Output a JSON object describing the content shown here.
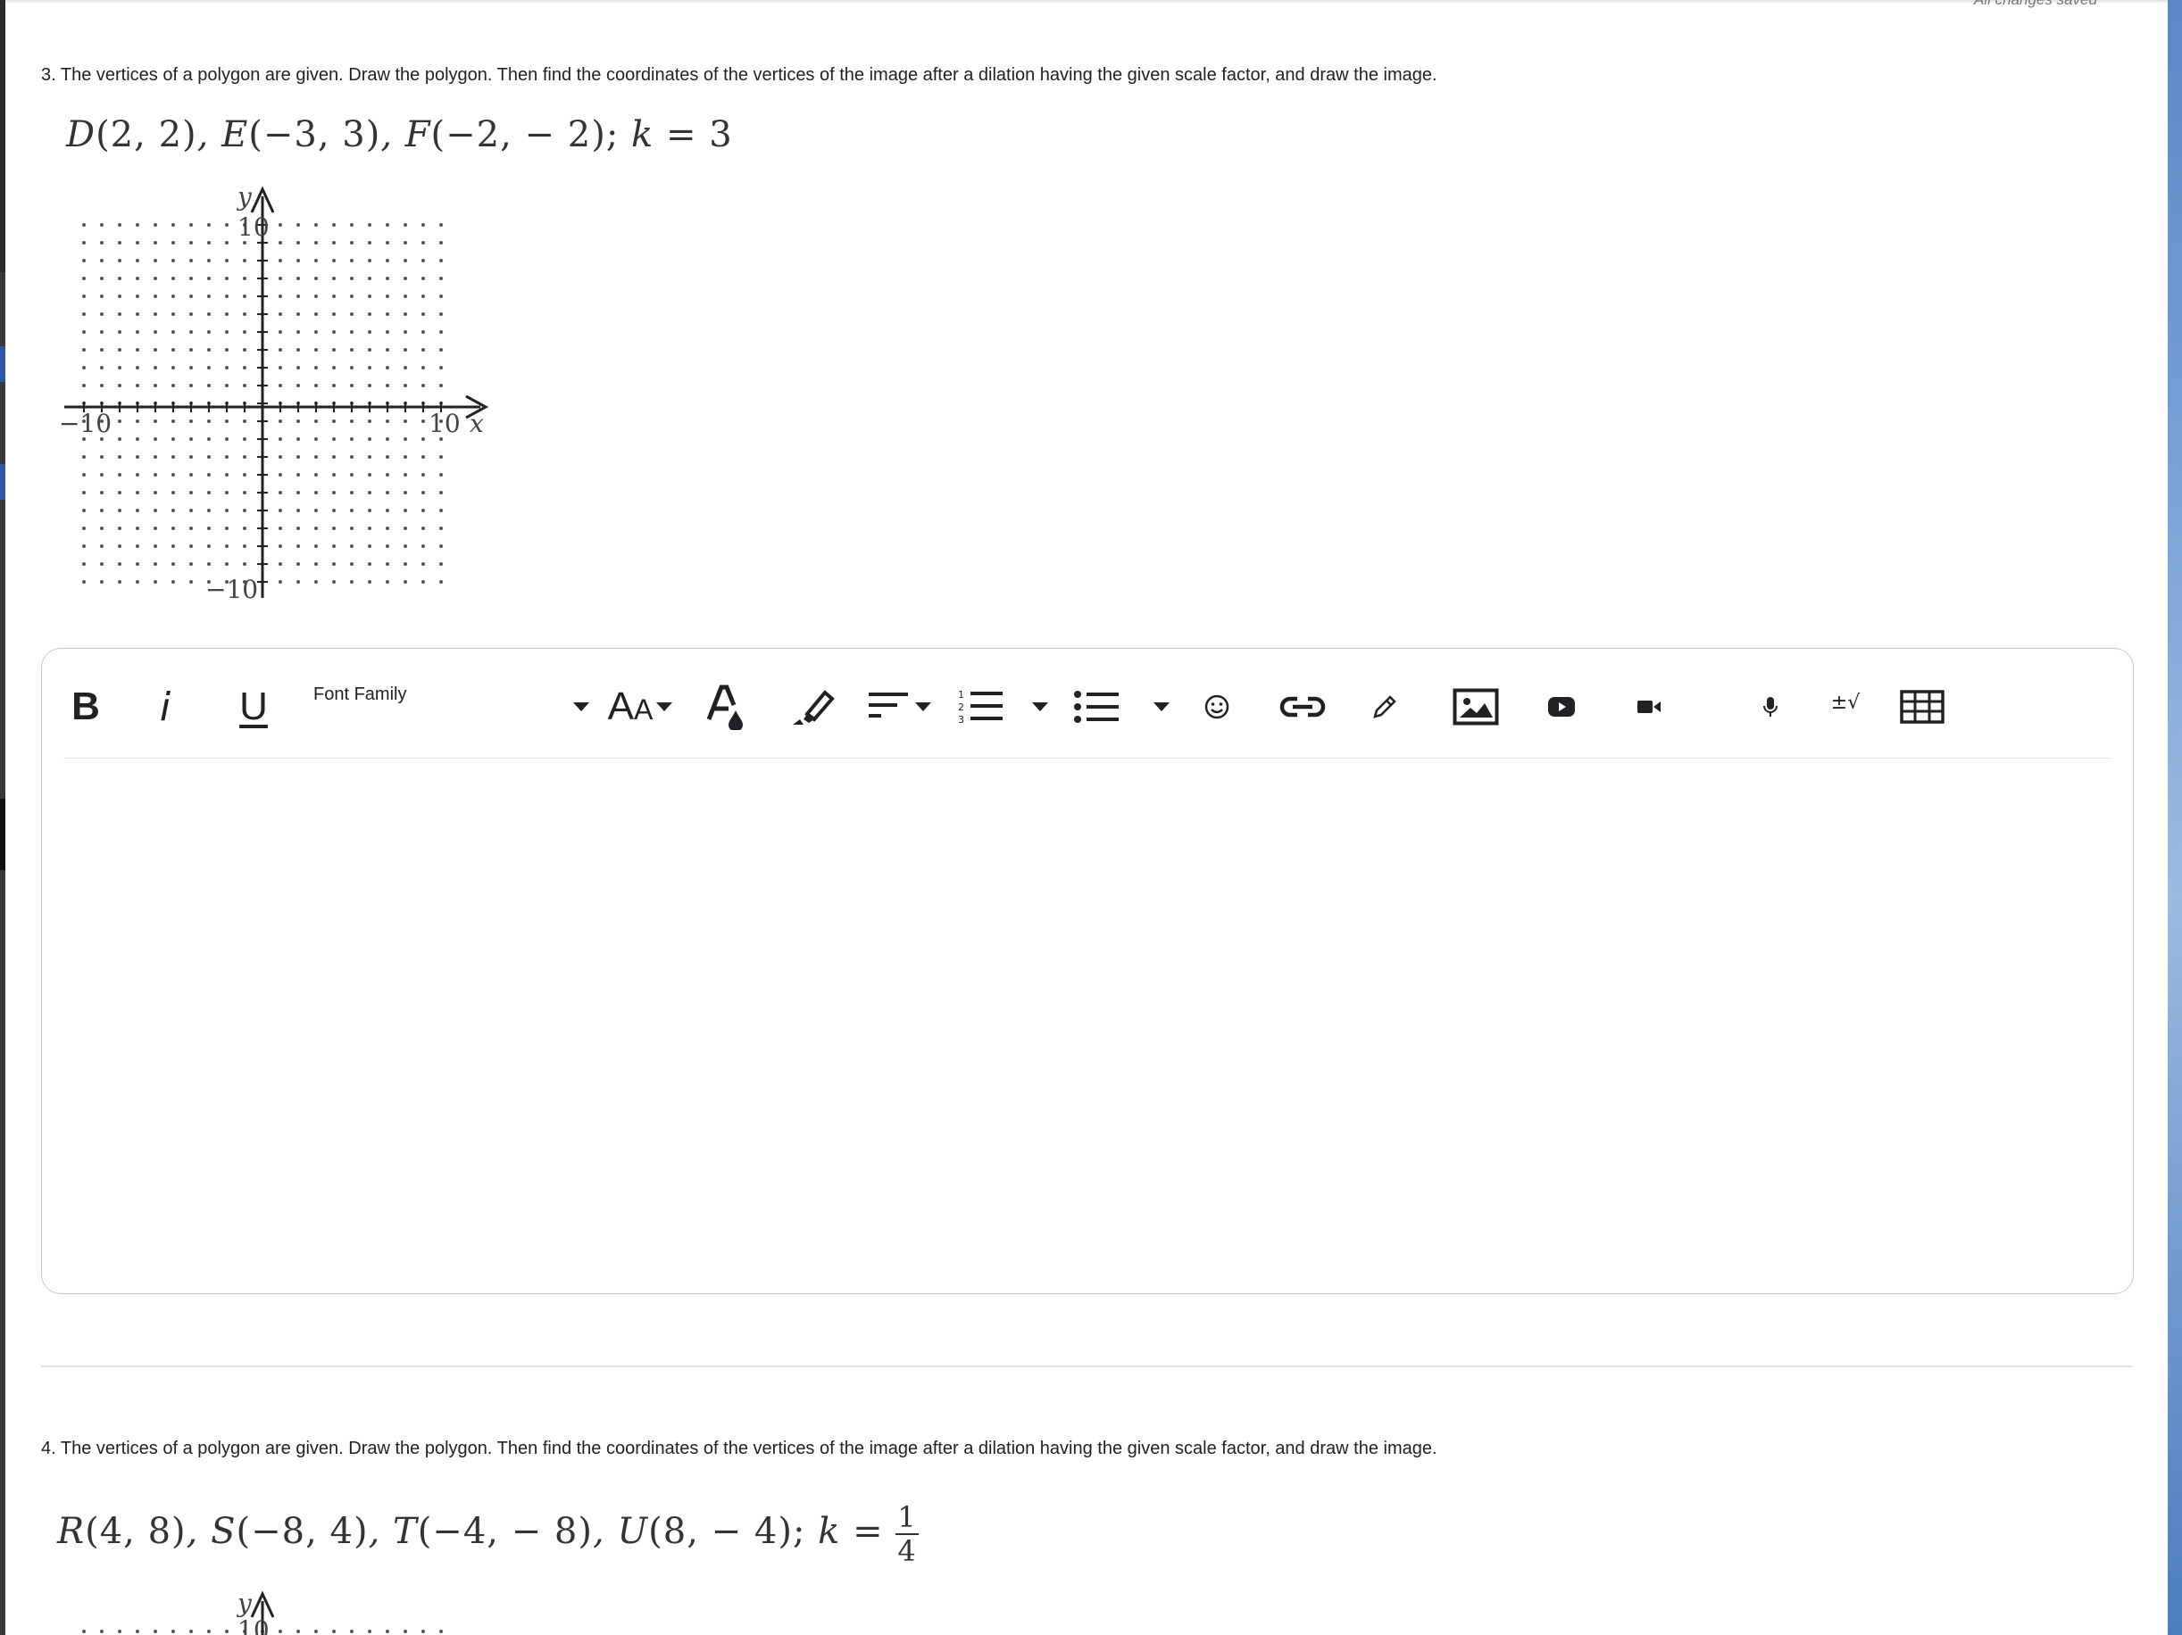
{
  "status": {
    "saved_text": "All changes saved"
  },
  "questions": [
    {
      "text": "3. The vertices of a polygon are given. Draw the polygon. Then find the coordinates of the vertices of the image after a dilation having the given scale factor, and draw the image.",
      "vertices": [
        {
          "label": "D",
          "coords": "(2, 2)"
        },
        {
          "label": "E",
          "coords": "(−3, 3)"
        },
        {
          "label": "F",
          "coords": "(−2, − 2)"
        }
      ],
      "scale_label": "k",
      "scale_value": "3",
      "grid": {
        "x_min_label": "−10",
        "x_max_label": "10",
        "y_max_label": "10",
        "y_min_label": "−10",
        "x_axis": "x",
        "y_axis": "y"
      }
    },
    {
      "text": "4. The vertices of a polygon are given. Draw the polygon. Then find the coordinates of the vertices of the image after a dilation having the given scale factor, and draw the image.",
      "vertices": [
        {
          "label": "R",
          "coords": "(4, 8)"
        },
        {
          "label": "S",
          "coords": "(−8, 4)"
        },
        {
          "label": "T",
          "coords": "(−4, − 8)"
        },
        {
          "label": "U",
          "coords": "(8, − 4)"
        }
      ],
      "scale_label": "k",
      "scale_num": "1",
      "scale_den": "4",
      "grid": {
        "y_max_label": "10",
        "y_axis": "y"
      }
    }
  ],
  "editor": {
    "font_family_label": "Font Family",
    "toolbar_icons": [
      "bold-icon",
      "italic-icon",
      "underline-icon",
      "font-size-icon",
      "text-color-icon",
      "highlight-icon",
      "align-icon",
      "numbered-list-icon",
      "bullet-list-icon",
      "emoji-icon",
      "link-icon",
      "draw-icon",
      "image-icon",
      "youtube-icon",
      "video-icon",
      "microphone-icon",
      "equation-icon",
      "table-icon"
    ],
    "bold_glyph": "B",
    "italic_glyph": "i",
    "underline_glyph": "U",
    "font_size_glyph_big": "A",
    "font_size_glyph_small": "A",
    "equation_glyph": "±√",
    "content": ""
  }
}
